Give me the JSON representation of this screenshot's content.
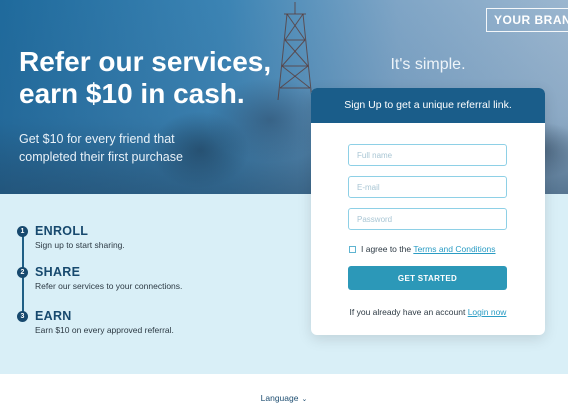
{
  "brand": {
    "label": "YOUR BRAND"
  },
  "hero": {
    "title": "Refer our services, earn $10 in cash.",
    "subtitle": "Get $10 for every friend that completed their first purchase",
    "tagline": "It's simple."
  },
  "steps": [
    {
      "number": "1",
      "title": "ENROLL",
      "description": "Sign up to start sharing."
    },
    {
      "number": "2",
      "title": "SHARE",
      "description": "Refer our services to your connections."
    },
    {
      "number": "3",
      "title": "EARN",
      "description": "Earn $10 on every approved referral."
    }
  ],
  "form": {
    "header": "Sign Up to get a unique referral link.",
    "fullname_placeholder": "Full name",
    "email_placeholder": "E-mail",
    "password_placeholder": "Password",
    "fullname_value": "",
    "email_value": "",
    "password_value": "",
    "agree_text": "I agree to the",
    "terms_link": "Terms and Conditions",
    "agree_checked": false,
    "submit_label": "GET STARTED",
    "login_prompt": "If you already have an account",
    "login_link": "Login now"
  },
  "footer": {
    "language_label": "Language"
  },
  "icons": {
    "chevron": "chevron-down-icon",
    "checkbox": "checkbox-icon"
  },
  "colors": {
    "accent": "#2c98b8",
    "header_blue": "#1a5d8a",
    "step_blue": "#17496e",
    "band_bg": "#d9eff7",
    "link": "#2a9cc4"
  }
}
